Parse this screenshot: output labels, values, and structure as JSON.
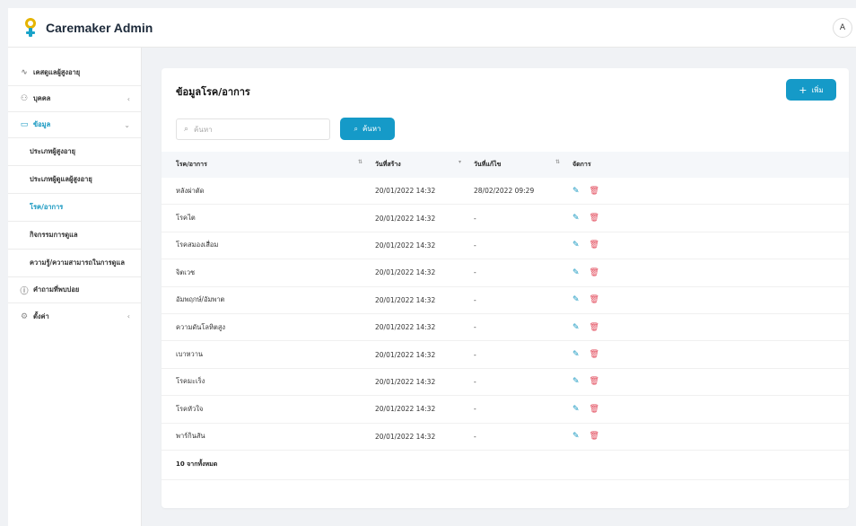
{
  "app": {
    "title": "Caremaker Admin",
    "avatar_initial": "A"
  },
  "sidebar": {
    "items": [
      {
        "label": "เคสดูแลผู้สูงอายุ",
        "icon": "activity-icon"
      },
      {
        "label": "บุคคล",
        "icon": "users-icon"
      },
      {
        "label": "ข้อมูล",
        "icon": "database-icon"
      },
      {
        "label": "คำถามที่พบบ่อย",
        "icon": "question-icon"
      },
      {
        "label": "ตั้งค่า",
        "icon": "gear-icon"
      }
    ],
    "sub_items": [
      {
        "label": "ประเภทผู้สูงอายุ"
      },
      {
        "label": "ประเภทผู้ดูแลผู้สูงอายุ"
      },
      {
        "label": "โรค/อาการ"
      },
      {
        "label": "กิจกรรมการดูแล"
      },
      {
        "label": "ความรู้/ความสามารถในการดูแล"
      }
    ]
  },
  "page": {
    "title": "ข้อมูลโรค/อาการ",
    "add_label": "เพิ่ม",
    "search_placeholder": "ค้นหา",
    "search_button": "ค้นหา"
  },
  "table": {
    "columns": [
      "โรค/อาการ",
      "วันที่สร้าง",
      "วันที่แก้ไข",
      "จัดการ"
    ],
    "rows": [
      {
        "name": "หลังผ่าตัด",
        "created": "20/01/2022 14:32",
        "updated": "28/02/2022 09:29"
      },
      {
        "name": "โรคไต",
        "created": "20/01/2022 14:32",
        "updated": "-"
      },
      {
        "name": "โรคสมองเสื่อม",
        "created": "20/01/2022 14:32",
        "updated": "-"
      },
      {
        "name": "จิตเวช",
        "created": "20/01/2022 14:32",
        "updated": "-"
      },
      {
        "name": "อัมพฤกษ์/อัมพาต",
        "created": "20/01/2022 14:32",
        "updated": "-"
      },
      {
        "name": "ความดันโลหิตสูง",
        "created": "20/01/2022 14:32",
        "updated": "-"
      },
      {
        "name": "เบาหวาน",
        "created": "20/01/2022 14:32",
        "updated": "-"
      },
      {
        "name": "โรคมะเร็ง",
        "created": "20/01/2022 14:32",
        "updated": "-"
      },
      {
        "name": "โรคหัวใจ",
        "created": "20/01/2022 14:32",
        "updated": "-"
      },
      {
        "name": "พาร์กินสัน",
        "created": "20/01/2022 14:32",
        "updated": "-"
      }
    ],
    "footer": "10 จากทั้งหมด"
  },
  "colors": {
    "accent": "#159ac8",
    "danger": "#e24b5c",
    "logo_yellow": "#e5b400"
  }
}
